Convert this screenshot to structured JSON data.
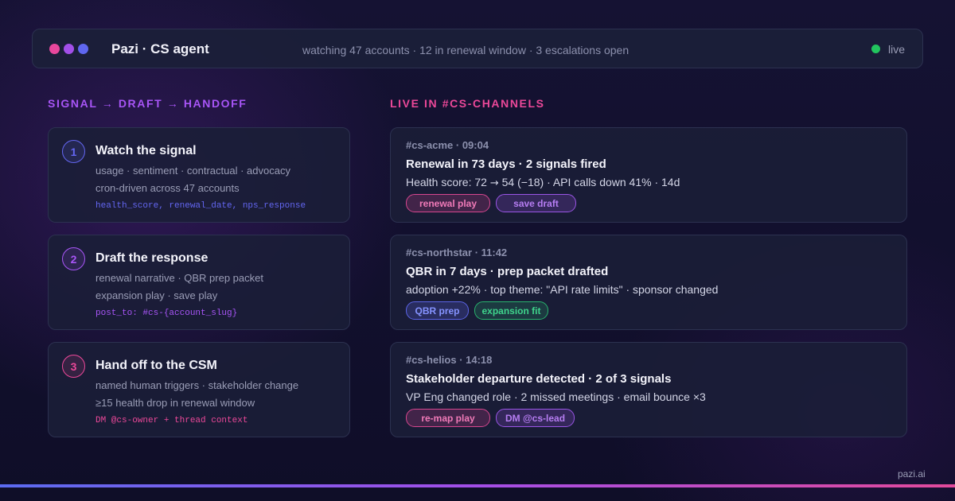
{
  "header": {
    "title": "Pazi · CS agent",
    "status": "watching 47 accounts · 12 in renewal window · 3 escalations open",
    "live_label": "live",
    "window_dot_colors": [
      "#e8479c",
      "#a24fe8",
      "#5f66f0"
    ],
    "live_color": "#22c55e"
  },
  "left_heading": "SIGNAL → DRAFT → HANDOFF",
  "right_heading": "LIVE IN #CS-CHANNELS",
  "colors": {
    "left_heading": "#a855f7",
    "right_heading": "#ec4899"
  },
  "steps": [
    {
      "number": "1",
      "title": "Watch the signal",
      "line1": "usage · sentiment · contractual · advocacy",
      "line2": "cron-driven across 47 accounts",
      "code": "health_score, renewal_date, nps_response",
      "accent": "#6366f1"
    },
    {
      "number": "2",
      "title": "Draft the response",
      "line1": "renewal narrative · QBR prep packet",
      "line2": "expansion play · save play",
      "code": "post_to: #cs-{account_slug}",
      "accent": "#a855f7"
    },
    {
      "number": "3",
      "title": "Hand off to the CSM",
      "line1": "named human triggers · stakeholder change",
      "line2": "≥15 health drop in renewal window",
      "code": "DM @cs-owner + thread context",
      "accent": "#ec4899"
    }
  ],
  "feed": [
    {
      "channel_time": "#cs-acme · 09:04",
      "title": "Renewal in 73 days · 2 signals fired",
      "body_before": "Health score: 72 ",
      "body_arrow": "→",
      "body_after": " 54 (−18) · API calls down 41% · 14d",
      "chips": [
        {
          "label": "renewal play",
          "style": "pink"
        },
        {
          "label": "save draft",
          "style": "purple"
        }
      ]
    },
    {
      "channel_time": "#cs-northstar · 11:42",
      "title": "QBR in 7 days · prep packet drafted",
      "body_before": "adoption +22% · top theme: \"API rate limits\" · sponsor changed",
      "body_arrow": "",
      "body_after": "",
      "chips": [
        {
          "label": "QBR prep",
          "style": "blue"
        },
        {
          "label": "expansion fit",
          "style": "green"
        }
      ]
    },
    {
      "channel_time": "#cs-helios · 14:18",
      "title": "Stakeholder departure detected · 2 of 3 signals",
      "body_before": "VP Eng changed role · 2 missed meetings · email bounce ×3",
      "body_arrow": "",
      "body_after": "",
      "chips": [
        {
          "label": "re-map play",
          "style": "pink"
        },
        {
          "label": "DM @cs-lead",
          "style": "purple"
        }
      ]
    }
  ],
  "footer": {
    "brand": "pazi.ai"
  }
}
